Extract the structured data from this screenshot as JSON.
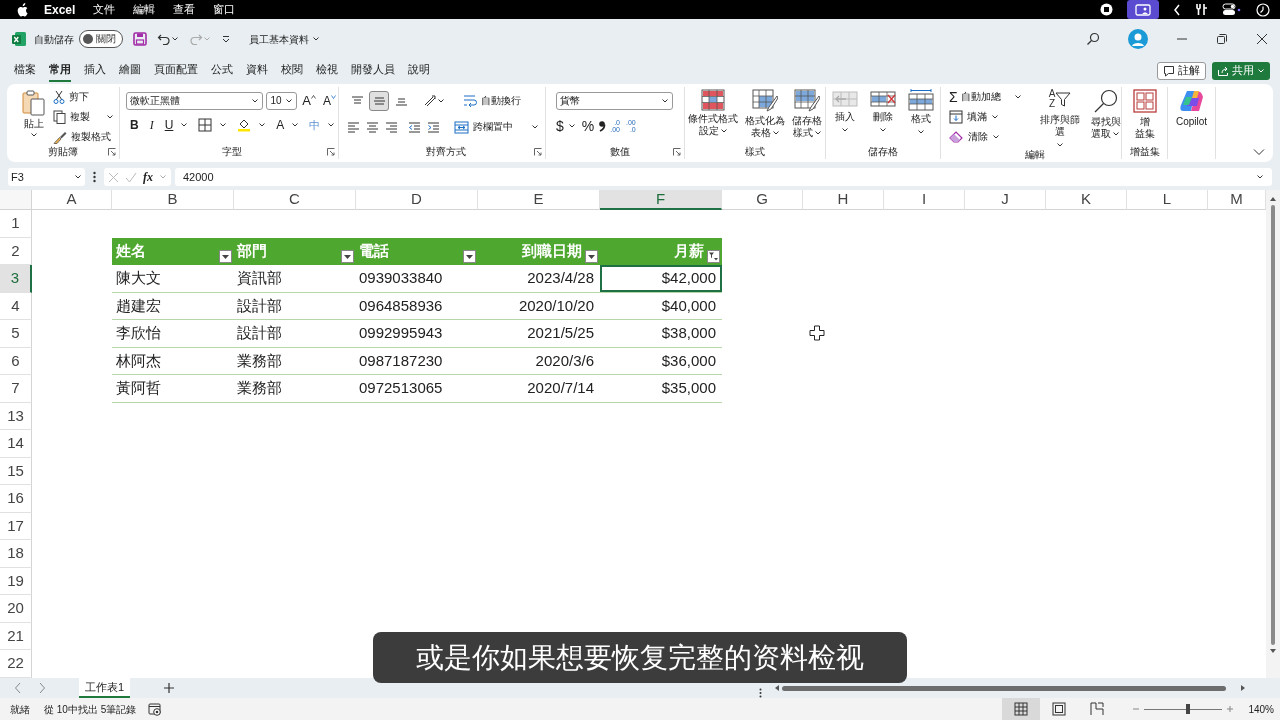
{
  "menu_bar": {
    "app_name": "Excel",
    "menus": [
      "文件",
      "編輯",
      "查看",
      "窗口"
    ]
  },
  "title_bar": {
    "autosave_label": "自動儲存",
    "autosave_toggle": {
      "on": false,
      "label": "關閉"
    },
    "file_name": "員工基本資料"
  },
  "tabs": [
    {
      "label": "檔案",
      "selected": false
    },
    {
      "label": "常用",
      "selected": true
    },
    {
      "label": "插入",
      "selected": false
    },
    {
      "label": "繪圖",
      "selected": false
    },
    {
      "label": "頁面配置",
      "selected": false
    },
    {
      "label": "公式",
      "selected": false
    },
    {
      "label": "資料",
      "selected": false
    },
    {
      "label": "校閱",
      "selected": false
    },
    {
      "label": "檢視",
      "selected": false
    },
    {
      "label": "開發人員",
      "selected": false
    },
    {
      "label": "說明",
      "selected": false
    }
  ],
  "comments_button": "註解",
  "share_button": "共用",
  "ribbon": {
    "clipboard": {
      "paste": "貼上",
      "cut": "剪下",
      "copy": "複製",
      "format_painter": "複製格式",
      "group_label": "剪貼簿"
    },
    "font": {
      "font_name": "微軟正黑體",
      "font_size": "10",
      "grow_font": "A",
      "shrink_font": "A",
      "bold": "B",
      "italic": "I",
      "underline": "U",
      "font_color": "A",
      "phonetic": "中",
      "group_label": "字型"
    },
    "alignment": {
      "vertical": [
        {
          "kind": "top",
          "selected": false
        },
        {
          "kind": "middle",
          "selected": true
        },
        {
          "kind": "bottom",
          "selected": false
        }
      ],
      "wrap_text": "自動換行",
      "merge_center": "跨欄置中",
      "group_label": "對齊方式"
    },
    "number": {
      "format": "貨幣",
      "currency": "$",
      "percent": "%",
      "increase_decimal": [
        ".0",
        ".00"
      ],
      "decrease_decimal": [
        ".00",
        ".0"
      ],
      "group_label": "數值"
    },
    "styles": {
      "conditional_formatting": [
        "條件式格式",
        "設定"
      ],
      "format_as_table": [
        "格式化為",
        "表格"
      ],
      "cell_styles": [
        "儲存格",
        "樣式"
      ],
      "group_label": "樣式"
    },
    "cells": {
      "insert": "插入",
      "delete": "刪除",
      "format": "格式",
      "group_label": "儲存格"
    },
    "editing": {
      "autosum_symbol": "Σ",
      "autosum": "自動加總",
      "fill": "填滿",
      "clear": "清除",
      "sort_letters": [
        "A",
        "Z"
      ],
      "sort_filter": "排序與篩選",
      "find_select": [
        "尋找與",
        "選取"
      ],
      "group_label": "編輯"
    },
    "add_ins": {
      "label": [
        "增",
        "益集"
      ],
      "group_label": "增益集"
    },
    "copilot": "Copilot"
  },
  "formula_bar": {
    "name_box": "F3",
    "fx": "fx",
    "formula": "42000"
  },
  "column_headers": [
    {
      "label": "A",
      "selected": false
    },
    {
      "label": "B",
      "selected": false
    },
    {
      "label": "C",
      "selected": false
    },
    {
      "label": "D",
      "selected": false
    },
    {
      "label": "E",
      "selected": false
    },
    {
      "label": "F",
      "selected": true
    },
    {
      "label": "G",
      "selected": false
    },
    {
      "label": "H",
      "selected": false
    },
    {
      "label": "I",
      "selected": false
    },
    {
      "label": "J",
      "selected": false
    },
    {
      "label": "K",
      "selected": false
    },
    {
      "label": "L",
      "selected": false
    },
    {
      "label": "M",
      "selected": false
    }
  ],
  "row_headers": [
    {
      "label": "1",
      "selected": false
    },
    {
      "label": "2",
      "selected": false
    },
    {
      "label": "3",
      "selected": true
    },
    {
      "label": "4",
      "selected": false
    },
    {
      "label": "5",
      "selected": false
    },
    {
      "label": "6",
      "selected": false
    },
    {
      "label": "7",
      "selected": false
    },
    {
      "label": "13",
      "selected": false
    },
    {
      "label": "14",
      "selected": false
    },
    {
      "label": "15",
      "selected": false
    },
    {
      "label": "16",
      "selected": false
    },
    {
      "label": "17",
      "selected": false
    },
    {
      "label": "18",
      "selected": false
    },
    {
      "label": "19",
      "selected": false
    },
    {
      "label": "20",
      "selected": false
    },
    {
      "label": "21",
      "selected": false
    },
    {
      "label": "22",
      "selected": false
    }
  ],
  "table": {
    "headers": [
      {
        "label": "姓名",
        "kind": "dropdown"
      },
      {
        "label": "部門",
        "kind": "dropdown"
      },
      {
        "label": "電話",
        "kind": "dropdown"
      },
      {
        "label": "到職日期",
        "kind": "dropdown"
      },
      {
        "label": "月薪",
        "kind": "filtered"
      }
    ],
    "rows": [
      {
        "cells": [
          {
            "text": "陳大文",
            "selected": false
          },
          {
            "text": "資訊部",
            "selected": false
          },
          {
            "text": "0939033840",
            "selected": false
          },
          {
            "text": "2023/4/28",
            "selected": false
          },
          {
            "text": "$42,000",
            "selected": true
          }
        ]
      },
      {
        "cells": [
          {
            "text": "趙建宏",
            "selected": false
          },
          {
            "text": "設計部",
            "selected": false
          },
          {
            "text": "0964858936",
            "selected": false
          },
          {
            "text": "2020/10/20",
            "selected": false
          },
          {
            "text": "$40,000",
            "selected": false
          }
        ]
      },
      {
        "cells": [
          {
            "text": "李欣怡",
            "selected": false
          },
          {
            "text": "設計部",
            "selected": false
          },
          {
            "text": "0992995943",
            "selected": false
          },
          {
            "text": "2021/5/25",
            "selected": false
          },
          {
            "text": "$38,000",
            "selected": false
          }
        ]
      },
      {
        "cells": [
          {
            "text": "林阿杰",
            "selected": false
          },
          {
            "text": "業務部",
            "selected": false
          },
          {
            "text": "0987187230",
            "selected": false
          },
          {
            "text": "2020/3/6",
            "selected": false
          },
          {
            "text": "$36,000",
            "selected": false
          }
        ]
      },
      {
        "cells": [
          {
            "text": "黃阿哲",
            "selected": false
          },
          {
            "text": "業務部",
            "selected": false
          },
          {
            "text": "0972513065",
            "selected": false
          },
          {
            "text": "2020/7/14",
            "selected": false
          },
          {
            "text": "$35,000",
            "selected": false
          }
        ]
      }
    ]
  },
  "sheet_tabs": [
    {
      "label": "工作表1",
      "selected": true
    }
  ],
  "status_bar": {
    "ready": "就緒",
    "filter_status": "從 10中找出 5筆記錄",
    "views": [
      {
        "kind": "normal",
        "selected": true
      },
      {
        "kind": "page_layout",
        "selected": false
      },
      {
        "kind": "page_break",
        "selected": false
      }
    ],
    "zoom": {
      "level": 0.56,
      "reading": "140%"
    }
  },
  "subtitle": "或是你如果想要恢复完整的资料检视"
}
